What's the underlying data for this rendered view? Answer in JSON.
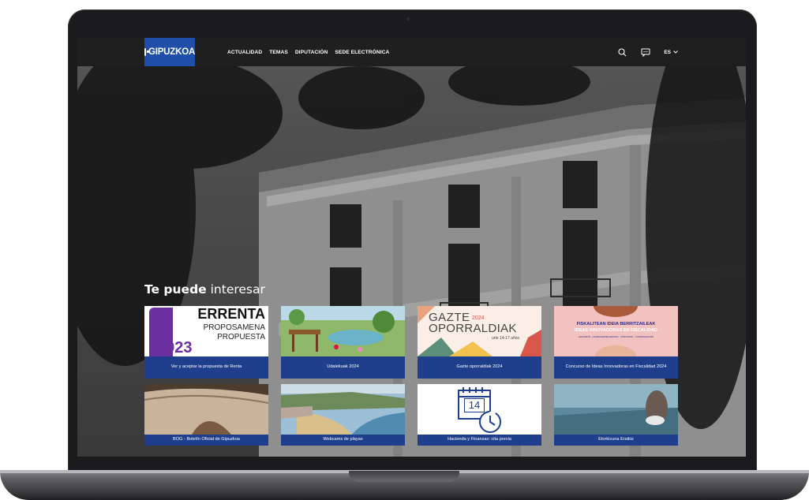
{
  "nav": {
    "logo_text": "GIPUZKOA",
    "menu": [
      "ACTUALIDAD",
      "TEMAS",
      "DIPUTACIÓN",
      "SEDE ELECTRÓNICA"
    ],
    "lang": "ES",
    "icons": [
      "search-icon",
      "chat-icon",
      "chevron-down-icon"
    ]
  },
  "section": {
    "title_bold": "Te puede",
    "title_light": "interesar"
  },
  "cards": [
    {
      "caption": "Ver y aceptar la propuesta de Renta",
      "img": {
        "line1": "ERRENTA",
        "line2": "PROPOSAMENA",
        "line3": "PROPUESTA",
        "year": "2023"
      }
    },
    {
      "caption": "Udalekuak 2024"
    },
    {
      "caption": "Gazte oporraldiak 2024",
      "img": {
        "line1": "GAZTE",
        "year": "2024",
        "line2": "OPORRALDIAK",
        "sub": "urte 14-17 años"
      }
    },
    {
      "caption": "Concurso de Ideas Innovadoras en Fiscalidad 2024",
      "img": {
        "line1": "FISKALITEAN IDEIA BERRITZAILEAK",
        "line2": "IDEAS INNOVADORAS EN FISCALIDAD",
        "line3": "LEHIAKETA · LAURAGARREN EDIZIOA · CONCURSO · CUARTA EDICIÓN"
      }
    },
    {
      "caption": "BOG - Boletín Oficial de Gipuzkoa"
    },
    {
      "caption": "Webcams de playas"
    },
    {
      "caption": "Hacienda y Finanzas: cita previa",
      "img": {
        "day": "14"
      }
    },
    {
      "caption": "Etorkizuna Eraikiz"
    }
  ],
  "colors": {
    "accent": "#1f3f8c",
    "logo_bg": "#1f4fa8",
    "nav_bg": "#1f1f1f"
  }
}
